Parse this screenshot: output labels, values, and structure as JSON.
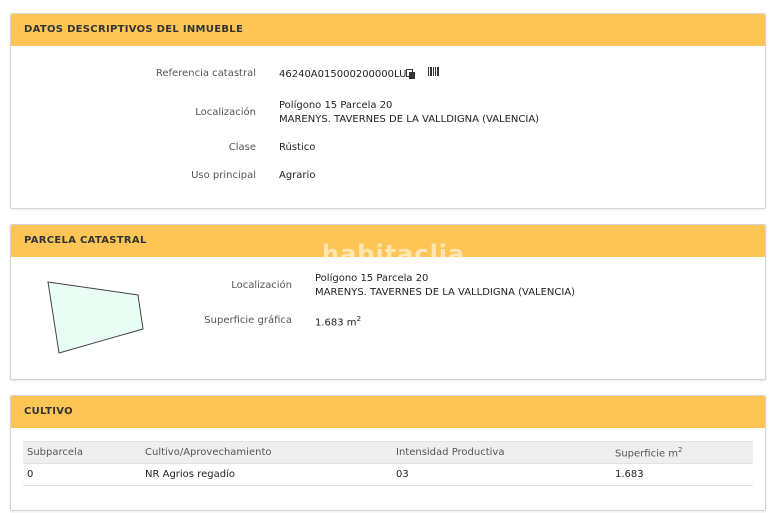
{
  "descriptivos": {
    "title": "DATOS DESCRIPTIVOS DEL INMUEBLE",
    "rows": [
      {
        "label": "Referencia catastral",
        "value": "46240A015000200000LU"
      },
      {
        "label": "Localización",
        "value": "Polígono 15 Parcela 20",
        "value2": "MARENYS. TAVERNES DE LA VALLDIGNA (VALENCIA)"
      },
      {
        "label": "Clase",
        "value": "Rústico"
      },
      {
        "label": "Uso principal",
        "value": "Agrario"
      }
    ]
  },
  "parcela": {
    "title": "PARCELA CATASTRAL",
    "watermark": "habitaclia",
    "loc_label": "Localización",
    "loc_value": "Polígono 15 Parcela 20",
    "loc_value2": "MARENYS. TAVERNES DE LA VALLDIGNA (VALENCIA)",
    "sup_label": "Superficie gráfica",
    "sup_value": "1.683 m",
    "sup_unit_exp": "2",
    "shape_fill": "#e8fdf3"
  },
  "cultivo": {
    "title": "CULTIVO",
    "headers": [
      "Subparcela",
      "Cultivo/Aprovechamiento",
      "Intensidad Productiva",
      "Superficie m"
    ],
    "header_sup_exp": "2",
    "rows": [
      [
        "0",
        "NR Agrios regadío",
        "03",
        "1.683"
      ]
    ]
  },
  "colors": {
    "header_bg": "#fcc556"
  },
  "icons": [
    "copy-icon",
    "barcode-icon"
  ]
}
